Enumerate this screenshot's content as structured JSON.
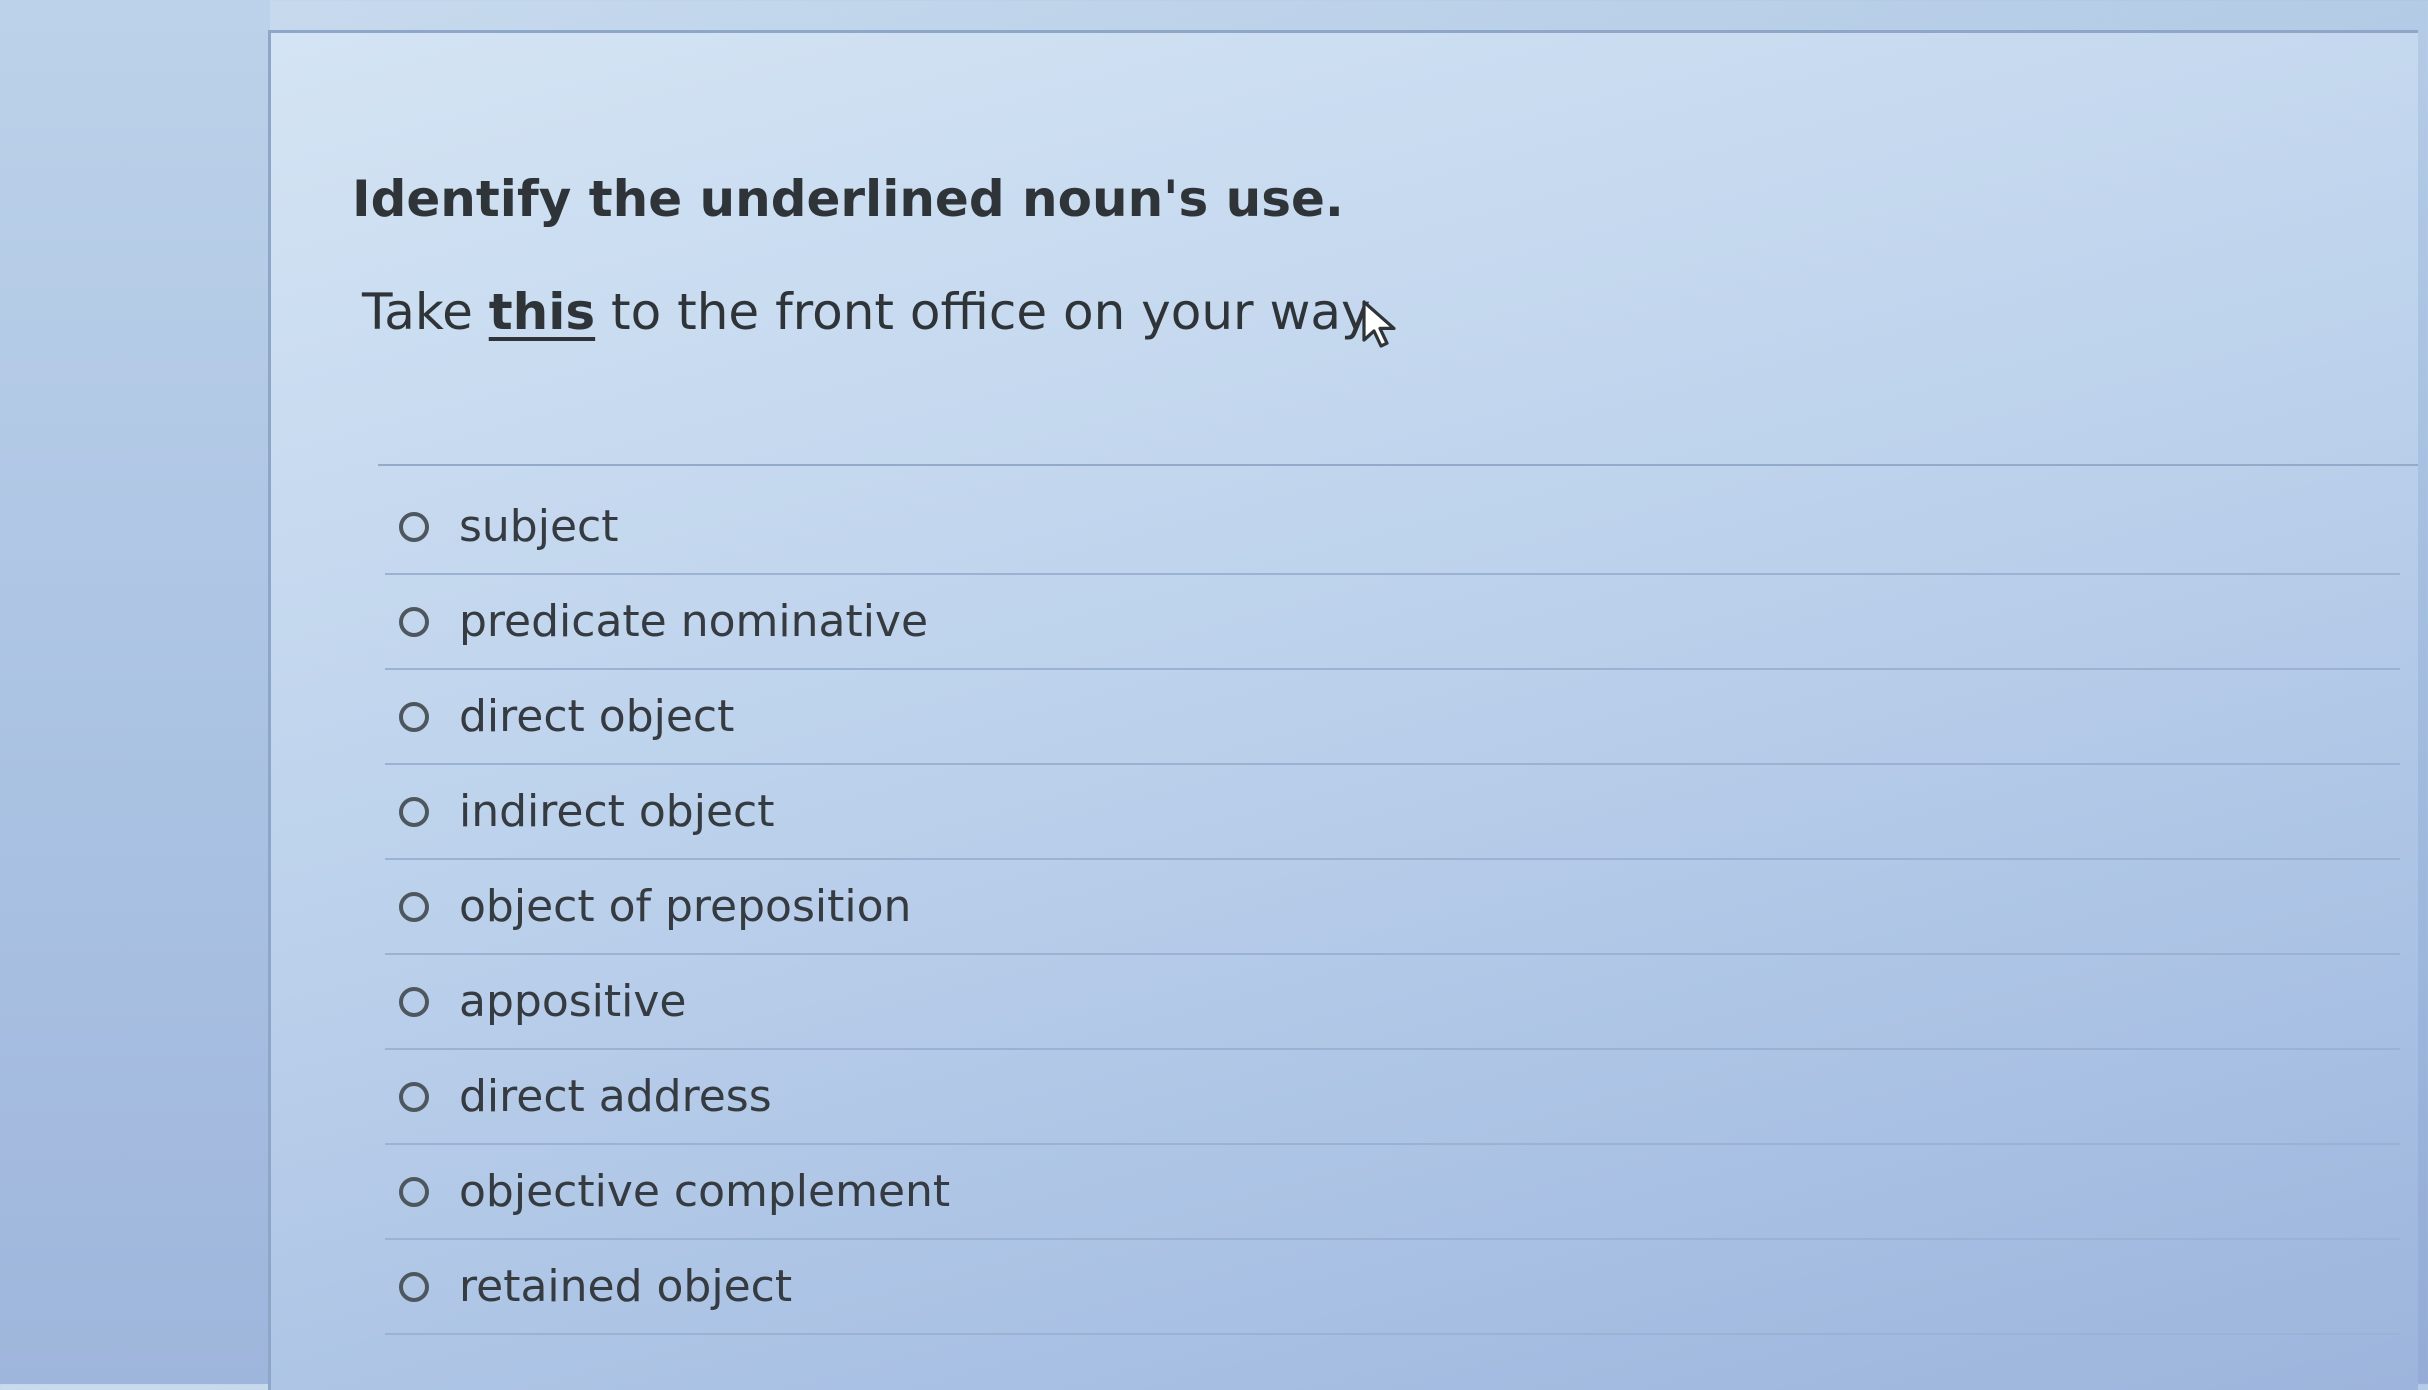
{
  "question": {
    "title": "Identify the underlined noun's use.",
    "sentence_before": "Take ",
    "underlined_word": "this",
    "sentence_after": " to the front office on your way."
  },
  "options": [
    {
      "label": "subject",
      "selected": false
    },
    {
      "label": "predicate nominative",
      "selected": false
    },
    {
      "label": "direct object",
      "selected": false
    },
    {
      "label": "indirect object",
      "selected": false
    },
    {
      "label": "object of preposition",
      "selected": false
    },
    {
      "label": "appositive",
      "selected": false
    },
    {
      "label": "direct address",
      "selected": false
    },
    {
      "label": "objective complement",
      "selected": false
    },
    {
      "label": "retained object",
      "selected": false
    }
  ],
  "icons": {
    "cursor": "mouse-pointer-icon",
    "radio": "radio-button-empty"
  },
  "colors": {
    "text": "#2f3438",
    "background": "#b3cbe6"
  }
}
